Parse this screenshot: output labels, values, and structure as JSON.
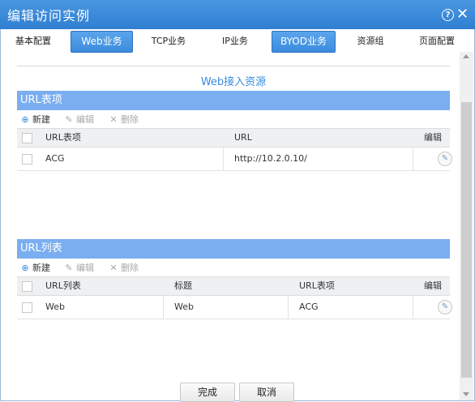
{
  "window": {
    "title": "编辑访问实例"
  },
  "tabs": [
    {
      "label": "基本配置",
      "active": false
    },
    {
      "label": "Web业务",
      "active": true
    },
    {
      "label": "TCP业务",
      "active": false
    },
    {
      "label": "IP业务",
      "active": false
    },
    {
      "label": "BYOD业务",
      "active": true
    },
    {
      "label": "资源组",
      "active": false
    },
    {
      "label": "页面配置",
      "active": false
    }
  ],
  "section_title": "Web接入资源",
  "url_items_panel": {
    "title": "URL表项",
    "toolbar": {
      "new": "新建",
      "edit": "编辑",
      "delete": "删除"
    },
    "columns": [
      "URL表项",
      "URL",
      "编辑"
    ],
    "rows": [
      {
        "name": "ACG",
        "url": "http://10.2.0.10/"
      }
    ]
  },
  "url_list_panel": {
    "title": "URL列表",
    "toolbar": {
      "new": "新建",
      "edit": "编辑",
      "delete": "删除"
    },
    "columns": [
      "URL列表",
      "标题",
      "URL表项",
      "编辑"
    ],
    "rows": [
      {
        "list": "Web",
        "title": "Web",
        "item": "ACG"
      }
    ]
  },
  "footer": {
    "ok": "完成",
    "cancel": "取消"
  },
  "colors": {
    "accent": "#3c8bde",
    "panel_header": "#7aaef0",
    "titlebar": "#2f7fd2"
  }
}
